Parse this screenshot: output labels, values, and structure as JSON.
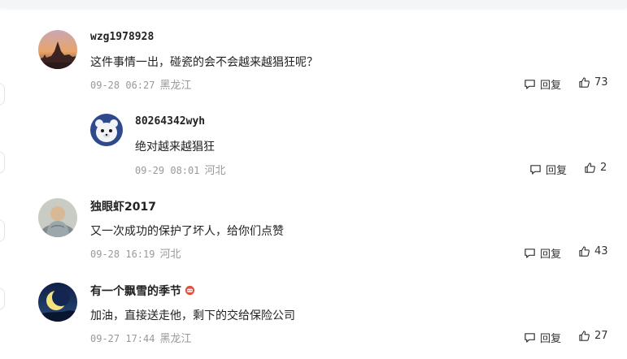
{
  "comments": [
    {
      "user": "wzg1978928",
      "text": "这件事情一出，碰瓷的会不会越来越猖狂呢？",
      "date": "09-28 06:27",
      "location": "黑龙江",
      "reply_label": "回复",
      "likes": "73",
      "avatar_icon": "sunset-cityscape-avatar"
    },
    {
      "user": "80264342wyh",
      "text": "绝对越来越猖狂",
      "date": "09-29 08:01",
      "location": "河北",
      "reply_label": "回复",
      "likes": "2",
      "avatar_icon": "cartoon-bear-avatar"
    },
    {
      "user": "独眼虾2017",
      "text": "又一次成功的保护了坏人，给你们点赞",
      "date": "09-28 16:19",
      "location": "河北",
      "reply_label": "回复",
      "likes": "43",
      "avatar_icon": "monk-statue-avatar"
    },
    {
      "user": "有一个飘雪的季节",
      "text": "加油，直接送走他，剩下的交给保险公司",
      "date": "09-27 17:44",
      "location": "黑龙江",
      "reply_label": "回复",
      "likes": "27",
      "avatar_icon": "crescent-moon-avatar",
      "badge_icon": "level-badge-icon"
    }
  ],
  "colors": {
    "text": "#222222",
    "meta": "#999999",
    "accent_badge": "#e0513f"
  }
}
